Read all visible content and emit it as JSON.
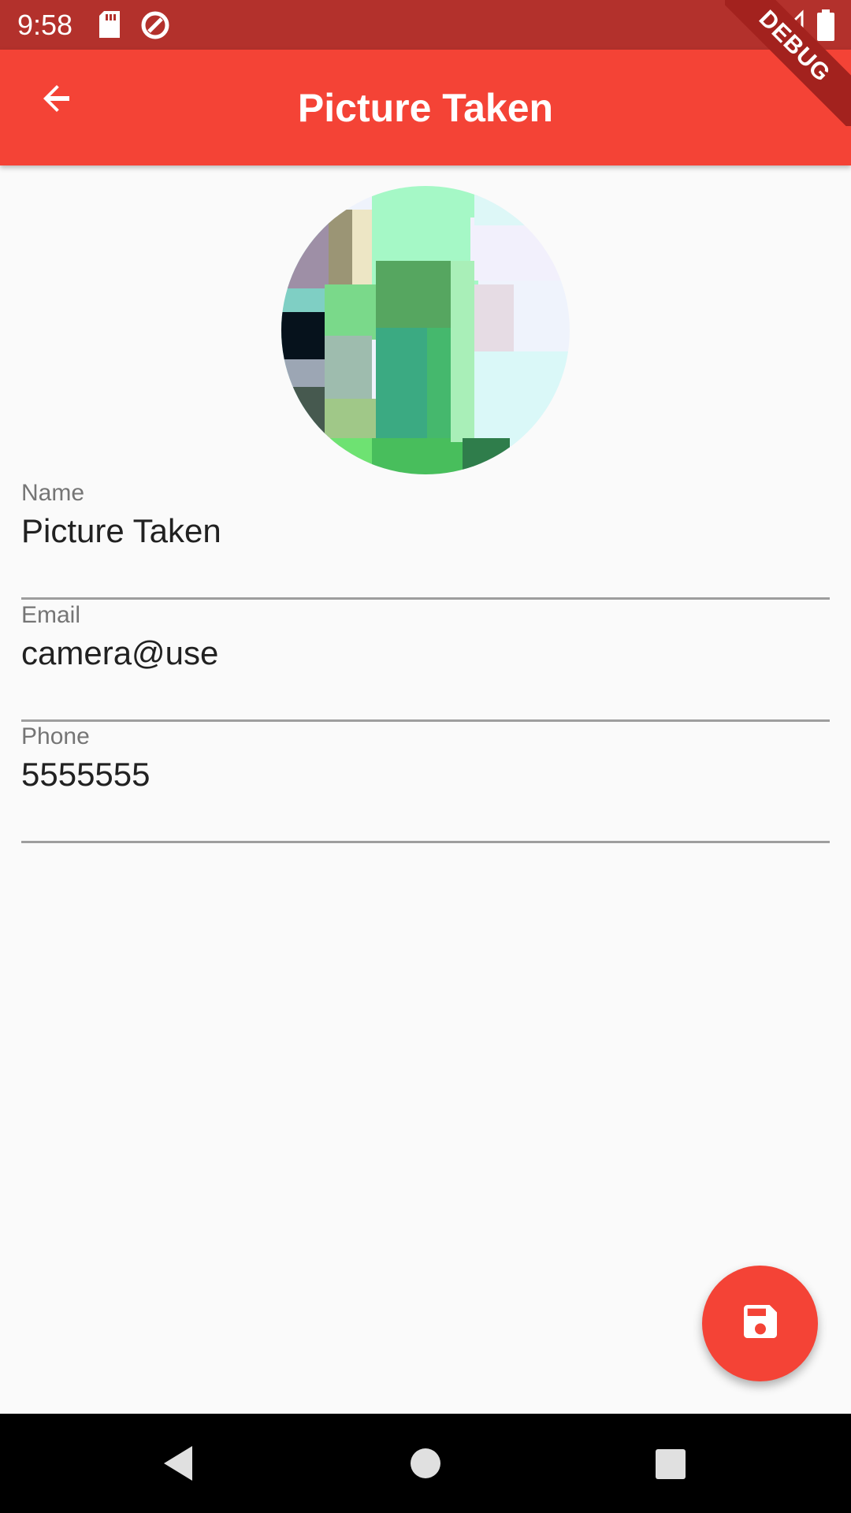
{
  "status_bar": {
    "time": "9:58",
    "icons": [
      "sd-card-icon",
      "data-saver-icon",
      "wifi-icon",
      "signal-icon",
      "battery-icon"
    ],
    "background": "#B3312C"
  },
  "app_bar": {
    "title": "Picture Taken",
    "back_icon": "arrow-back-icon",
    "background": "#F44336"
  },
  "debug_banner": {
    "label": "DEBUG"
  },
  "avatar": {
    "icon": "profile-photo"
  },
  "form": {
    "fields": [
      {
        "label": "Name",
        "value": "Picture Taken"
      },
      {
        "label": "Email",
        "value": "camera@use"
      },
      {
        "label": "Phone",
        "value": "5555555"
      }
    ]
  },
  "fab": {
    "icon": "save-icon",
    "color": "#F44336"
  },
  "nav_bar": {
    "buttons": [
      "back-triangle-icon",
      "home-circle-icon",
      "recents-square-icon"
    ]
  }
}
